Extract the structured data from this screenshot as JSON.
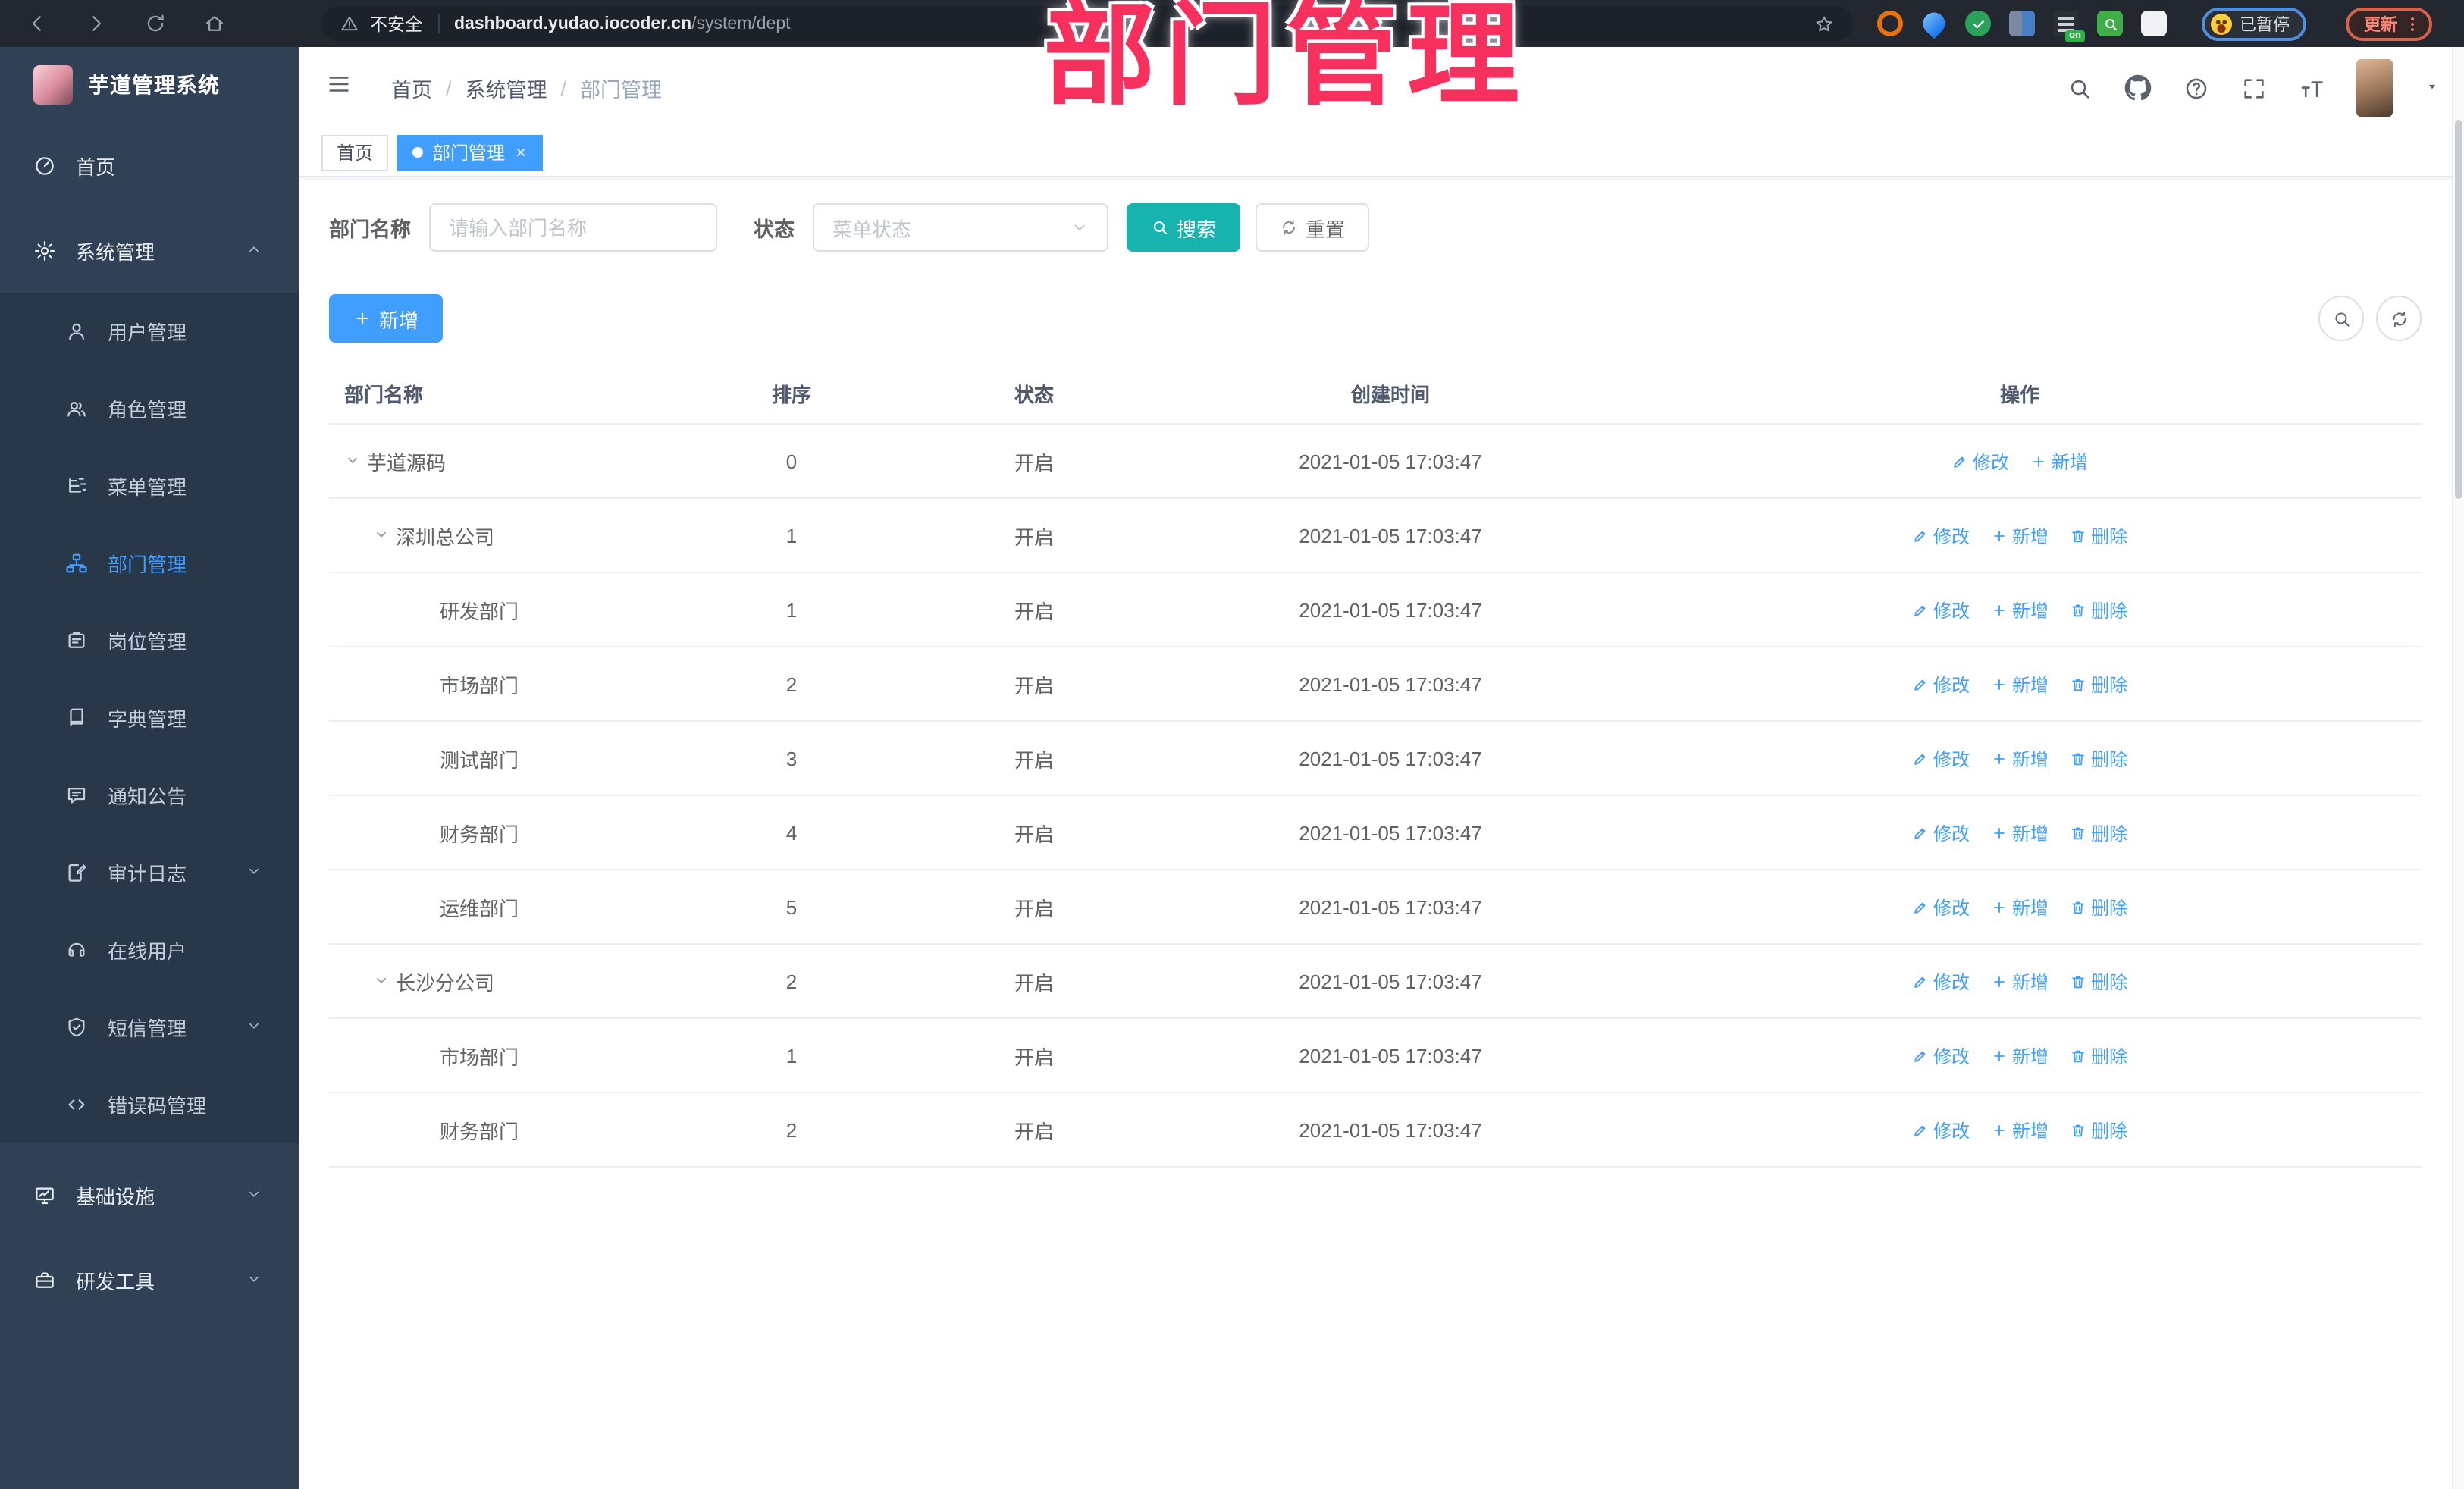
{
  "colors": {
    "accent": "#409eff",
    "teal": "#17b3ae",
    "pink": "#f7305e",
    "sidebar_bg": "#304156",
    "submenu_bg": "#293849"
  },
  "overlay_title": "部门管理",
  "browser": {
    "security_label": "不安全",
    "url_host": "dashboard.yudao.iocoder.cn",
    "url_path": "/system/dept",
    "extensions": [
      "ring-extension",
      "pin-extension",
      "check-extension",
      "grid-extension",
      "translate-on-extension",
      "search-extension",
      "puzzle-extension"
    ],
    "on_badge": "on",
    "paused_label": "已暂停",
    "update_label": "更新"
  },
  "sidebar": {
    "title": "芋道管理系统",
    "items": [
      {
        "label": "首页",
        "icon": "dash",
        "type": "top"
      },
      {
        "label": "系统管理",
        "icon": "gear",
        "type": "top",
        "chevron": "up"
      },
      {
        "label": "用户管理",
        "icon": "user",
        "type": "sub"
      },
      {
        "label": "角色管理",
        "icon": "users",
        "type": "sub"
      },
      {
        "label": "菜单管理",
        "icon": "tree",
        "type": "sub"
      },
      {
        "label": "部门管理",
        "icon": "org",
        "type": "sub",
        "active": true
      },
      {
        "label": "岗位管理",
        "icon": "card",
        "type": "sub"
      },
      {
        "label": "字典管理",
        "icon": "book",
        "type": "sub"
      },
      {
        "label": "通知公告",
        "icon": "notice",
        "type": "sub"
      },
      {
        "label": "审计日志",
        "icon": "log",
        "type": "sub",
        "chevron": "down"
      },
      {
        "label": "在线用户",
        "icon": "headset",
        "type": "sub"
      },
      {
        "label": "短信管理",
        "icon": "shield",
        "type": "sub",
        "chevron": "down"
      },
      {
        "label": "错误码管理",
        "icon": "code",
        "type": "sub"
      },
      {
        "label": "基础设施",
        "icon": "monitor",
        "type": "top",
        "chevron": "down",
        "gap_before": true
      },
      {
        "label": "研发工具",
        "icon": "case",
        "type": "top",
        "chevron": "down"
      }
    ]
  },
  "header": {
    "breadcrumb": [
      "首页",
      "系统管理",
      "部门管理"
    ]
  },
  "tabs": [
    {
      "label": "首页"
    },
    {
      "label": "部门管理",
      "active": true,
      "closable": true
    }
  ],
  "filters": {
    "dept_label": "部门名称",
    "dept_placeholder": "请输入部门名称",
    "status_label": "状态",
    "status_placeholder": "菜单状态",
    "search_label": "搜索",
    "reset_label": "重置"
  },
  "toolbar": {
    "add_label": "新增"
  },
  "table": {
    "columns": [
      "部门名称",
      "排序",
      "状态",
      "创建时间",
      "操作"
    ],
    "rows": [
      {
        "name": "芋道源码",
        "level": 0,
        "expandable": true,
        "sort": "0",
        "status": "开启",
        "created": "2021-01-05 17:03:47",
        "actions": [
          {
            "label": "修改",
            "icon": "edit"
          },
          {
            "label": "新增",
            "icon": "plus"
          }
        ]
      },
      {
        "name": "深圳总公司",
        "level": 1,
        "expandable": true,
        "sort": "1",
        "status": "开启",
        "created": "2021-01-05 17:03:47",
        "actions": [
          {
            "label": "修改",
            "icon": "edit"
          },
          {
            "label": "新增",
            "icon": "plus"
          },
          {
            "label": "删除",
            "icon": "trash"
          }
        ]
      },
      {
        "name": "研发部门",
        "level": 2,
        "expandable": false,
        "sort": "1",
        "status": "开启",
        "created": "2021-01-05 17:03:47",
        "actions": [
          {
            "label": "修改",
            "icon": "edit"
          },
          {
            "label": "新增",
            "icon": "plus"
          },
          {
            "label": "删除",
            "icon": "trash"
          }
        ]
      },
      {
        "name": "市场部门",
        "level": 2,
        "expandable": false,
        "sort": "2",
        "status": "开启",
        "created": "2021-01-05 17:03:47",
        "actions": [
          {
            "label": "修改",
            "icon": "edit"
          },
          {
            "label": "新增",
            "icon": "plus"
          },
          {
            "label": "删除",
            "icon": "trash"
          }
        ]
      },
      {
        "name": "测试部门",
        "level": 2,
        "expandable": false,
        "sort": "3",
        "status": "开启",
        "created": "2021-01-05 17:03:47",
        "actions": [
          {
            "label": "修改",
            "icon": "edit"
          },
          {
            "label": "新增",
            "icon": "plus"
          },
          {
            "label": "删除",
            "icon": "trash"
          }
        ]
      },
      {
        "name": "财务部门",
        "level": 2,
        "expandable": false,
        "sort": "4",
        "status": "开启",
        "created": "2021-01-05 17:03:47",
        "actions": [
          {
            "label": "修改",
            "icon": "edit"
          },
          {
            "label": "新增",
            "icon": "plus"
          },
          {
            "label": "删除",
            "icon": "trash"
          }
        ]
      },
      {
        "name": "运维部门",
        "level": 2,
        "expandable": false,
        "sort": "5",
        "status": "开启",
        "created": "2021-01-05 17:03:47",
        "actions": [
          {
            "label": "修改",
            "icon": "edit"
          },
          {
            "label": "新增",
            "icon": "plus"
          },
          {
            "label": "删除",
            "icon": "trash"
          }
        ]
      },
      {
        "name": "长沙分公司",
        "level": 1,
        "expandable": true,
        "sort": "2",
        "status": "开启",
        "created": "2021-01-05 17:03:47",
        "actions": [
          {
            "label": "修改",
            "icon": "edit"
          },
          {
            "label": "新增",
            "icon": "plus"
          },
          {
            "label": "删除",
            "icon": "trash"
          }
        ]
      },
      {
        "name": "市场部门",
        "level": 2,
        "expandable": false,
        "sort": "1",
        "status": "开启",
        "created": "2021-01-05 17:03:47",
        "actions": [
          {
            "label": "修改",
            "icon": "edit"
          },
          {
            "label": "新增",
            "icon": "plus"
          },
          {
            "label": "删除",
            "icon": "trash"
          }
        ]
      },
      {
        "name": "财务部门",
        "level": 2,
        "expandable": false,
        "sort": "2",
        "status": "开启",
        "created": "2021-01-05 17:03:47",
        "actions": [
          {
            "label": "修改",
            "icon": "edit"
          },
          {
            "label": "新增",
            "icon": "plus"
          },
          {
            "label": "删除",
            "icon": "trash"
          }
        ]
      }
    ]
  }
}
